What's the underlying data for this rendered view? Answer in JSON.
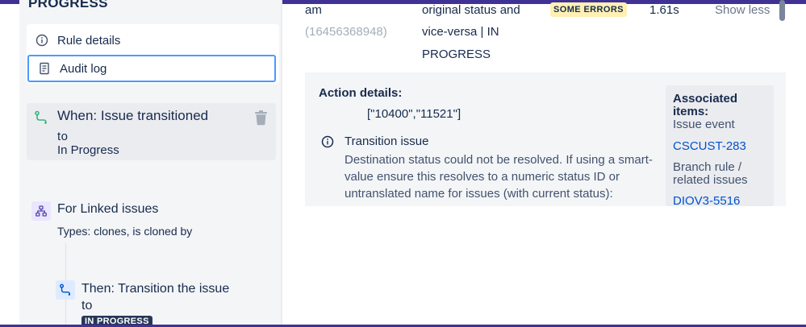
{
  "colors": {
    "accent_bar": "#403294",
    "link": "#0052cc",
    "focus_border": "#4c9aff",
    "badge_bg": "#fff0b3",
    "trigger_icon": "#36b37e",
    "lozenge_bg": "#253858"
  },
  "sidebar": {
    "section_title": "PROGRESS",
    "menu": [
      {
        "label": "Rule details",
        "icon": "info-icon"
      },
      {
        "label": "Audit log",
        "icon": "document-icon"
      }
    ],
    "trigger": {
      "title_line1": "When: Issue transitioned",
      "title_line2": "to",
      "subtitle": "In Progress",
      "icon": "transition-icon"
    },
    "branch": {
      "title": "For Linked issues",
      "subtitle": "Types: clones, is cloned by",
      "icon": "hierarchy-icon"
    },
    "action": {
      "title_line1": "Then: Transition the issue",
      "title_line2": "to",
      "lozenge": "IN PROGRESS",
      "icon": "transition-icon"
    }
  },
  "log_row": {
    "time_fragment": "am",
    "id": "(16456368948)",
    "description_lines": [
      "original status and",
      "vice-versa | IN",
      "PROGRESS"
    ],
    "status": "SOME ERRORS",
    "duration": "1.61s",
    "toggle": "Show less"
  },
  "action_details": {
    "title": "Action details:",
    "value": "[\"10400\",\"11521\"]",
    "transition_title": "Transition issue",
    "transition_message": "Destination status could not be resolved. If using a smart-value ensure this resolves to a numeric status ID or untranslated name for issues (with current status):",
    "associated": {
      "title": "Associated items:",
      "event_label": "Issue event",
      "event_link": "CSCUST-283",
      "branch_label": "Branch rule / related issues",
      "branch_link": "DIOV3-5516"
    }
  }
}
